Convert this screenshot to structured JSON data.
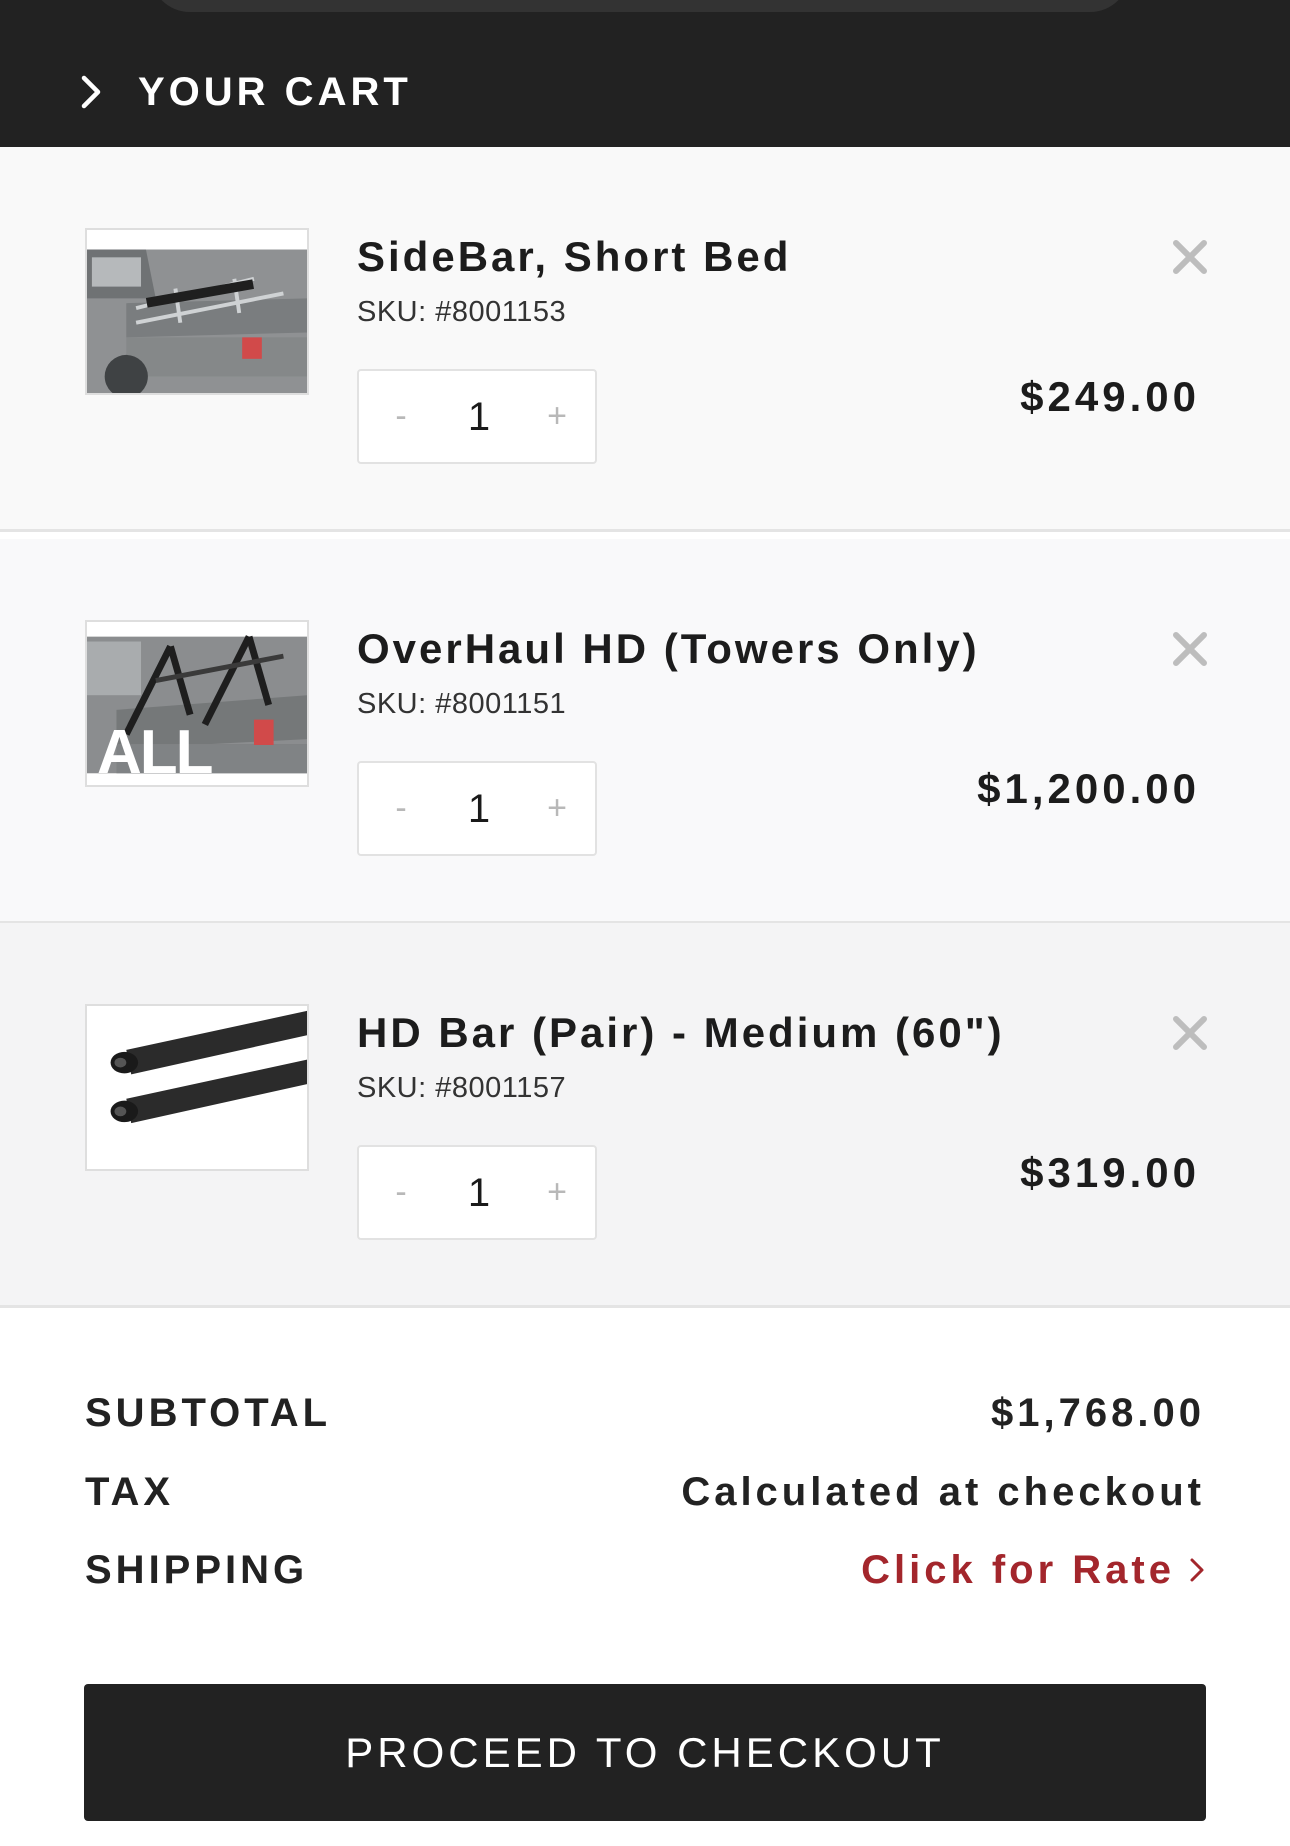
{
  "header": {
    "title": "YOUR CART"
  },
  "items": [
    {
      "name": "SideBar, Short Bed",
      "sku": "SKU: #8001153",
      "quantity": "1",
      "minus": "-",
      "plus": "+",
      "price": "$249.00"
    },
    {
      "name": "OverHaul HD (Towers Only)",
      "sku": "SKU: #8001151",
      "quantity": "1",
      "minus": "-",
      "plus": "+",
      "price": "$1,200.00",
      "thumb_overlay_text": "ALL"
    },
    {
      "name": "HD Bar (Pair) - Medium (60\")",
      "sku": "SKU: #8001157",
      "quantity": "1",
      "minus": "-",
      "plus": "+",
      "price": "$319.00"
    }
  ],
  "summary": {
    "subtotal_label": "SUBTOTAL",
    "subtotal_value": "$1,768.00",
    "tax_label": "TAX",
    "tax_value": "Calculated at checkout",
    "shipping_label": "SHIPPING",
    "shipping_value": "Click for Rate"
  },
  "checkout": {
    "label": "PROCEED TO CHECKOUT"
  },
  "colors": {
    "header_bg": "#222222",
    "link_red": "#a3262c",
    "button_bg": "#222222"
  },
  "icons": {
    "cart_toggle": "chevron-right-icon",
    "remove": "close-icon",
    "shipping_link": "chevron-right-icon"
  }
}
